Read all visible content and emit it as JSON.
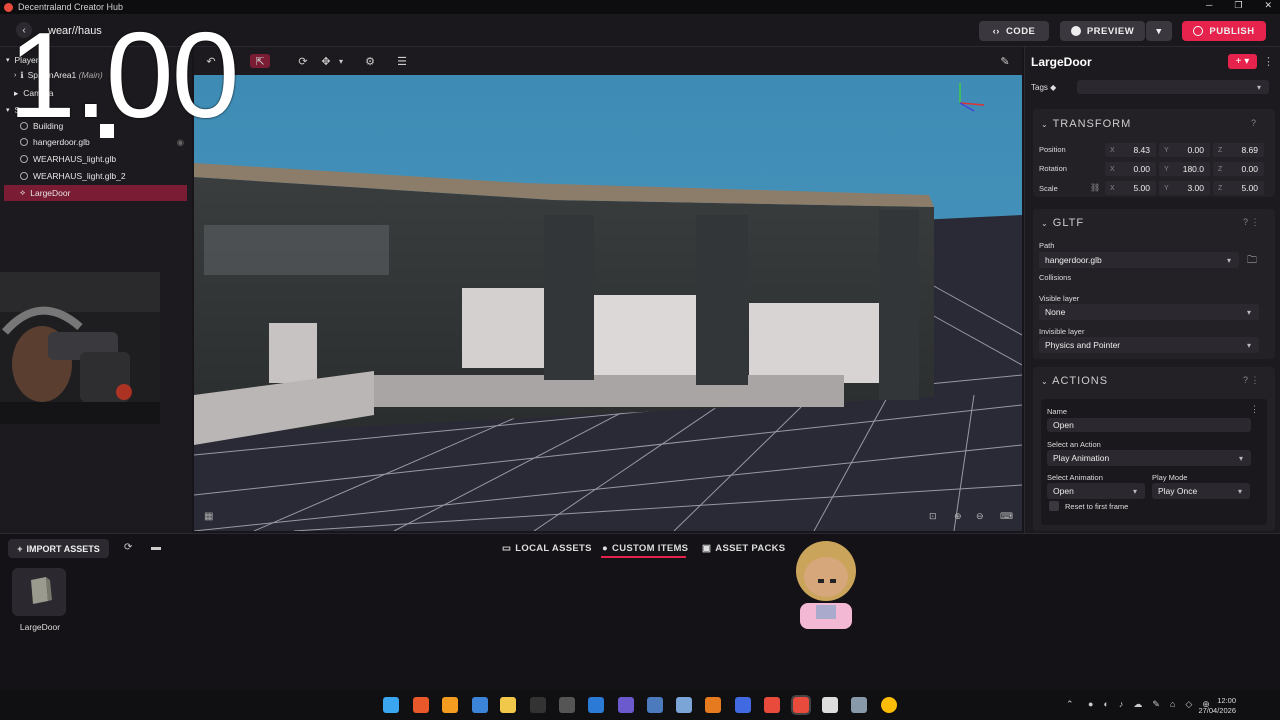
{
  "app": {
    "title": "Decentraland Creator Hub",
    "project": "wear//haus",
    "window_controls": [
      "─",
      "❐",
      "✕"
    ]
  },
  "overlay": {
    "timer": "1.00"
  },
  "header": {
    "code_label": "CODE",
    "preview_label": "PREVIEW",
    "publish_label": "PUBLISH"
  },
  "hierarchy": {
    "player": "Player",
    "spawn": "SpawnArea1",
    "spawn_tag": "(Main)",
    "camera": "Camera",
    "scene": "Scene",
    "items": [
      "Building",
      "hangerdoor.glb",
      "WEARHAUS_light.glb",
      "WEARHAUS_light.glb_2",
      "LargeDoor"
    ],
    "selected": "LargeDoor"
  },
  "inspector": {
    "entity_name": "LargeDoor",
    "tags_label": "Tags",
    "transform": {
      "title": "TRANSFORM",
      "position": {
        "label": "Position",
        "x": "8.43",
        "y": "0.00",
        "z": "8.69"
      },
      "rotation": {
        "label": "Rotation",
        "x": "0.00",
        "y": "180.0",
        "z": "0.00"
      },
      "scale": {
        "label": "Scale",
        "x": "5.00",
        "y": "3.00",
        "z": "5.00"
      }
    },
    "gltf": {
      "title": "GLTF",
      "path_label": "Path",
      "path": "hangerdoor.glb",
      "collisions_label": "Collisions",
      "visible_label": "Visible layer",
      "visible": "None",
      "invisible_label": "Invisible layer",
      "invisible": "Physics and Pointer"
    },
    "actions": {
      "title": "ACTIONS",
      "name_label": "Name",
      "name": "Open",
      "select_action_label": "Select an Action",
      "action": "Play Animation",
      "select_anim_label": "Select Animation",
      "anim": "Open",
      "play_mode_label": "Play Mode",
      "play_mode": "Play Once",
      "reset_label": "Reset to first frame"
    }
  },
  "assets": {
    "import_label": "IMPORT ASSETS",
    "tabs": [
      "LOCAL ASSETS",
      "CUSTOM ITEMS",
      "ASSET PACKS"
    ],
    "active_tab": "CUSTOM ITEMS",
    "items": [
      "LargeDoor"
    ]
  },
  "taskbar": {
    "time": "12:00",
    "date": "27/04/2026"
  },
  "colors": {
    "accent": "#e5234d",
    "selected_row": "#7a1c33",
    "sky": "#4a90b8"
  }
}
